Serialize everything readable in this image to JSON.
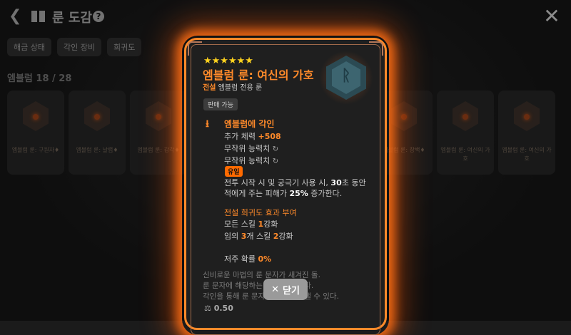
{
  "header": {
    "title": "룬 도감"
  },
  "filters": [
    "해금 상태",
    "각인 장비",
    "희귀도"
  ],
  "collection": {
    "count_label": "엠블럼 18 / 28"
  },
  "grid": [
    {
      "name": "엠블럼 룬: 구원자♦"
    },
    {
      "name": "엠블럼 룬: 날렵♦"
    },
    {
      "name": "엠블럼 룬: 감각♦"
    },
    {
      "name": "엠블럼 룬: 창백♦"
    },
    {
      "name": "엠블럼 룬: 여신의 가호"
    },
    {
      "name": "엠블럼 룬: 여신의 가호"
    }
  ],
  "detail": {
    "stars": "★★★★★★",
    "name": "엠블럼 룬: 여신의 가호",
    "grade_prefix": "전설",
    "grade_suffix": " 엠블럼 전용 룬",
    "sellable": "판매 가능",
    "engrave_title": "엠블럼에 각인",
    "stat1_label": "추가 체력 ",
    "stat1_value": "+508",
    "random1": "무작위 능력치",
    "random2": "무작위 능력치",
    "unique_badge": "유일",
    "effect_a": "전투 시작 시 및 궁극기 사용 시, ",
    "effect_a_num": "30",
    "effect_a_end": "초 동안",
    "effect_b": "적에게 주는 피해가 ",
    "effect_b_num": "25%",
    "effect_b_end": " 증가한다.",
    "legend_title": "전설 희귀도 효과 부여",
    "skill_a_pre": "모든 스킬 ",
    "skill_a_num": "1",
    "skill_a_post": "강화",
    "skill_b_pre": "임의 ",
    "skill_b_num": "3",
    "skill_b_mid": "개 스킬 ",
    "skill_b_num2": "2",
    "skill_b_post": "강화",
    "curse_label": "저주 확률 ",
    "curse_value": "0%",
    "desc1": "신비로운 마법의 룬 문자가 새겨진 돌.",
    "desc2": "룬 문자에 해당하는 힘이 담겨 있다.",
    "desc3": "각인을 통해 룬 문자의 힘을 끌어낼 수 있다.",
    "weight": "0.50",
    "close_label": "닫기"
  },
  "colors": {
    "accent": "#ff8a2a",
    "star": "#ffd21e",
    "unique": "#ff6a00"
  }
}
